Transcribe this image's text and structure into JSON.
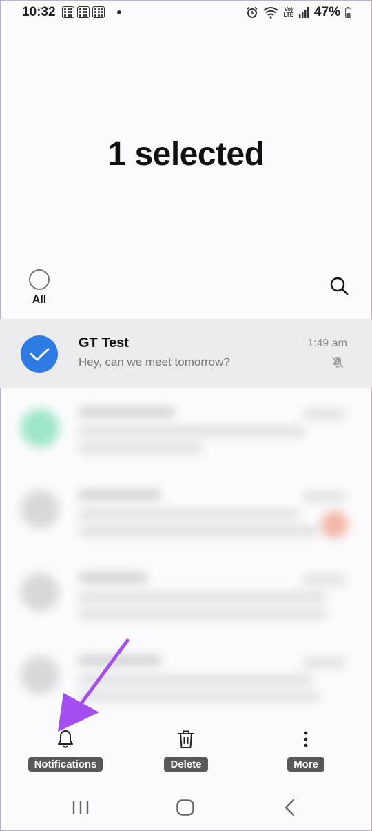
{
  "status_bar": {
    "time": "10:32",
    "battery_percent": "47%",
    "network_label_top": "Vo)",
    "network_label_bottom": "LTE"
  },
  "header": {
    "title": "1 selected"
  },
  "toolbar": {
    "select_all_label": "All"
  },
  "conversations": [
    {
      "name": "GT Test",
      "snippet": "Hey, can we meet tomorrow?",
      "time": "1:49 am",
      "selected": true,
      "muted": true
    }
  ],
  "bottom_actions": {
    "notifications_label": "Notifications",
    "delete_label": "Delete",
    "more_label": "More"
  },
  "colors": {
    "accent": "#2f7be5",
    "annotation_arrow": "#a44df0"
  }
}
